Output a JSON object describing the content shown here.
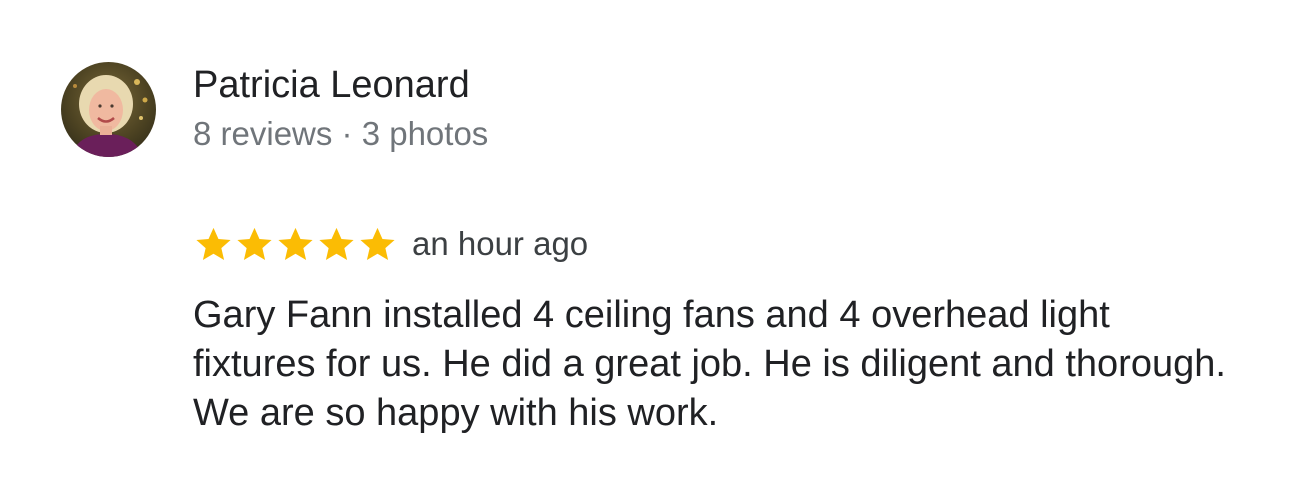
{
  "review": {
    "author": {
      "name": "Patricia Leonard",
      "meta": "8 reviews · 3 photos",
      "avatar_icon": "user-photo"
    },
    "rating": {
      "stars": 5,
      "max_stars": 5,
      "star_icon": "star-icon",
      "star_color": "#fbbc04"
    },
    "time_ago": "an hour ago",
    "text": "Gary Fann installed 4 ceiling fans and 4 overhead light fixtures for us. He did a great job. He is diligent and thorough. We are so happy with his work."
  },
  "colors": {
    "text_primary": "#202124",
    "text_secondary": "#70757a",
    "star": "#fbbc04",
    "background": "#ffffff"
  }
}
